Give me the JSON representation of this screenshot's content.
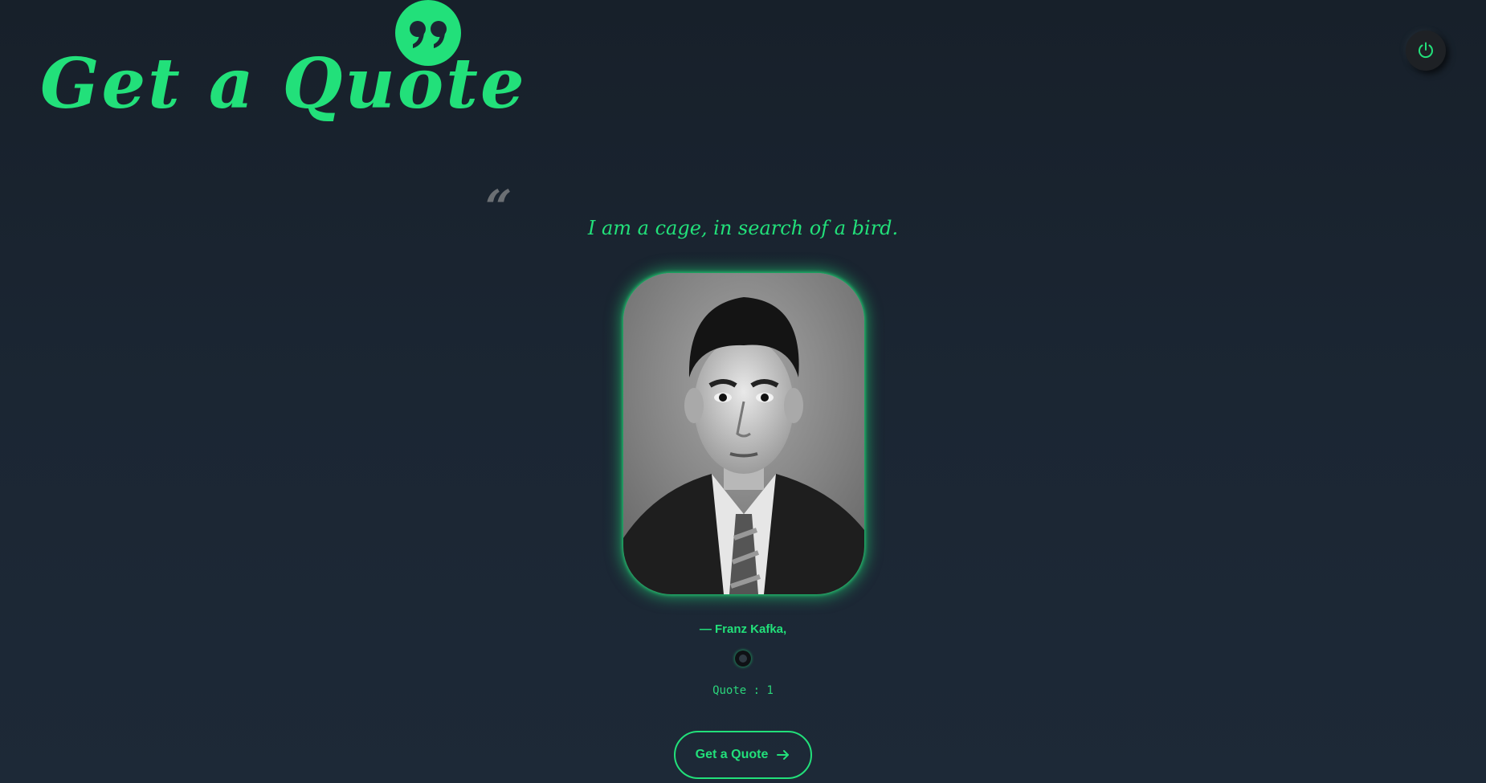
{
  "header": {
    "title": "Get a Quote",
    "badge_icon": "quote-marks-icon"
  },
  "power": {
    "icon": "power-icon"
  },
  "quote": {
    "open_mark": "“",
    "text": "I am a cage, in search of a bird.",
    "author": "— Franz Kafka,",
    "counter": "Quote : 1"
  },
  "action": {
    "button_label": "Get a Quote",
    "button_icon": "arrow-right-icon"
  },
  "colors": {
    "accent": "#22e07a",
    "background": "#1b2633",
    "muted_quote": "#6b6f73"
  }
}
